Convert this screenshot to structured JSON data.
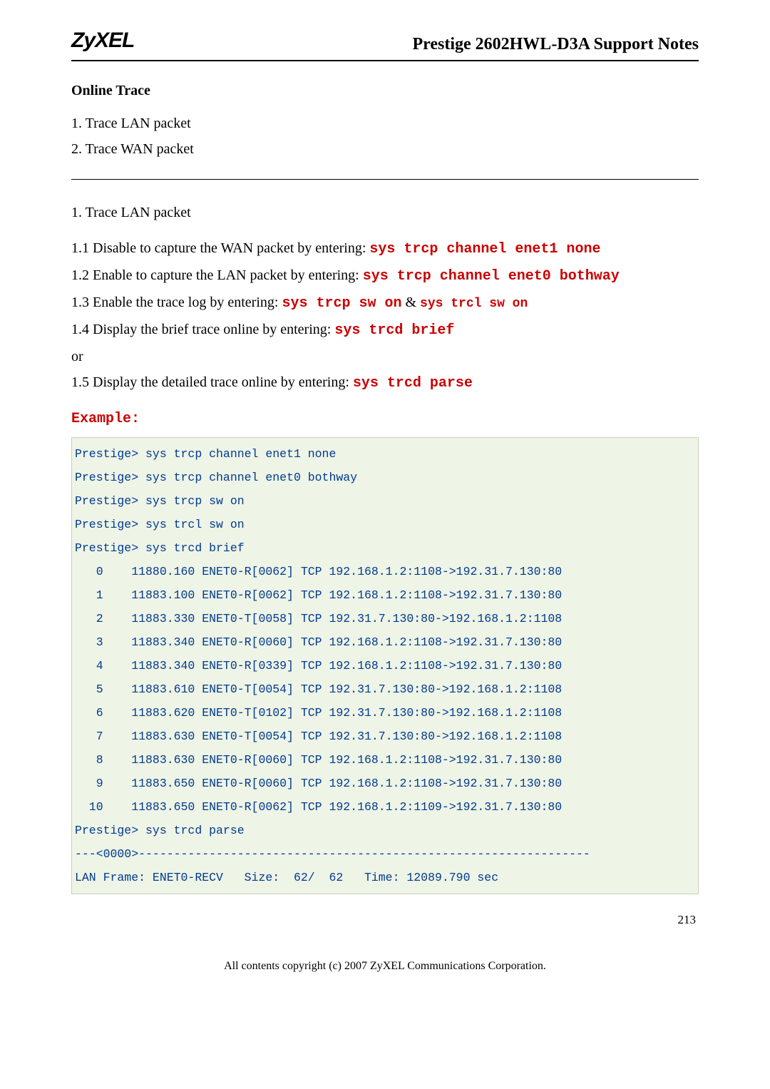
{
  "header": {
    "logo": "ZyXEL",
    "title": "Prestige 2602HWL-D3A Support Notes"
  },
  "section_heading": "Online Trace",
  "intro_lines": {
    "l1": "1. Trace LAN packet",
    "l2": "2. Trace WAN packet"
  },
  "sub_heading": "1. Trace LAN packet",
  "steps": {
    "s11_pre": "1.1 Disable to capture the WAN packet by entering: ",
    "s11_cmd": "sys trcp channel enet1 none",
    "s12_pre": "1.2 Enable to capture the LAN packet by entering: ",
    "s12_cmd": "sys trcp channel enet0 bothway",
    "s13_pre": "1.3 Enable the trace log by entering: ",
    "s13_cmd1": "sys trcp sw on",
    "s13_mid": " & ",
    "s13_cmd2": "sys trcl sw on",
    "s14_pre": "1.4 Display the brief trace online by entering: ",
    "s14_cmd": "sys trcd brief",
    "or_line": "or",
    "s15_pre": "1.5 Display the detailed trace online by entering: ",
    "s15_cmd": "sys trcd parse"
  },
  "example_label": "Example:",
  "code_lines": [
    "Prestige> sys trcp channel enet1 none",
    "Prestige> sys trcp channel enet0 bothway",
    "Prestige> sys trcp sw on",
    "Prestige> sys trcl sw on",
    "Prestige> sys trcd brief",
    "   0    11880.160 ENET0-R[0062] TCP 192.168.1.2:1108->192.31.7.130:80",
    "   1    11883.100 ENET0-R[0062] TCP 192.168.1.2:1108->192.31.7.130:80",
    "   2    11883.330 ENET0-T[0058] TCP 192.31.7.130:80->192.168.1.2:1108",
    "   3    11883.340 ENET0-R[0060] TCP 192.168.1.2:1108->192.31.7.130:80",
    "   4    11883.340 ENET0-R[0339] TCP 192.168.1.2:1108->192.31.7.130:80",
    "   5    11883.610 ENET0-T[0054] TCP 192.31.7.130:80->192.168.1.2:1108",
    "   6    11883.620 ENET0-T[0102] TCP 192.31.7.130:80->192.168.1.2:1108",
    "   7    11883.630 ENET0-T[0054] TCP 192.31.7.130:80->192.168.1.2:1108",
    "   8    11883.630 ENET0-R[0060] TCP 192.168.1.2:1108->192.31.7.130:80",
    "   9    11883.650 ENET0-R[0060] TCP 192.168.1.2:1108->192.31.7.130:80",
    "  10    11883.650 ENET0-R[0062] TCP 192.168.1.2:1109->192.31.7.130:80",
    "Prestige> sys trcd parse",
    "---<0000>----------------------------------------------------------------",
    "LAN Frame: ENET0-RECV   Size:  62/  62   Time: 12089.790 sec"
  ],
  "footer": {
    "page_number": "213",
    "copyright": "All contents copyright (c) 2007 ZyXEL Communications Corporation."
  }
}
